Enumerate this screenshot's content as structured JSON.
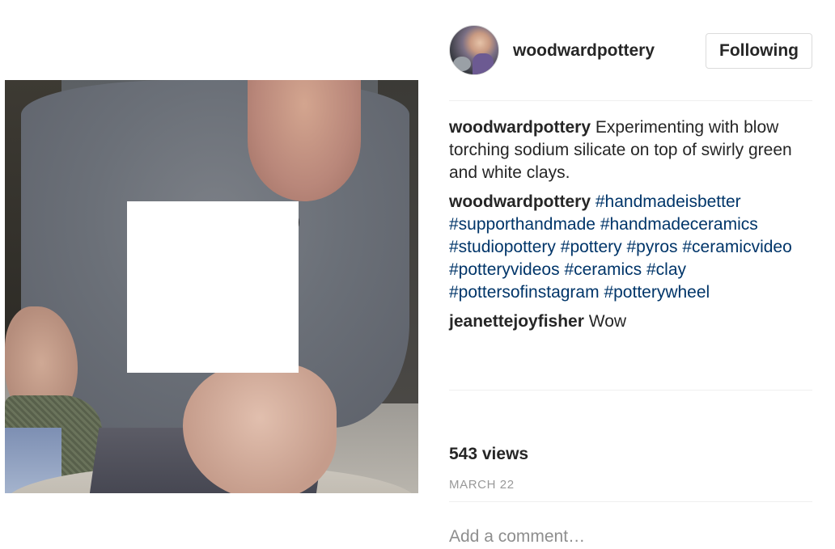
{
  "post": {
    "username": "woodwardpottery",
    "follow_label": "Following",
    "caption_user": "woodwardpottery",
    "caption_text": "Experimenting with blow torching sodium silicate on top of swirly green and white clays.",
    "hashtags_user": "woodwardpottery",
    "hashtags": [
      "#handmadeisbetter",
      "#supporthandmade",
      "#handmadeceramics",
      "#studiopottery",
      "#pottery",
      "#pyros",
      "#ceramicvideo",
      "#potteryvideos",
      "#ceramics",
      "#clay",
      "#pottersofinstagram",
      "#potterywheel"
    ],
    "comment_user": "jeanettejoyfisher",
    "comment_text": "Wow",
    "views": "543 views",
    "date": "MARCH 22",
    "add_comment_placeholder": "Add a comment…"
  },
  "colors": {
    "text": "#262626",
    "hashtag": "#003569",
    "muted": "#999999",
    "border": "#dbdbdb"
  }
}
